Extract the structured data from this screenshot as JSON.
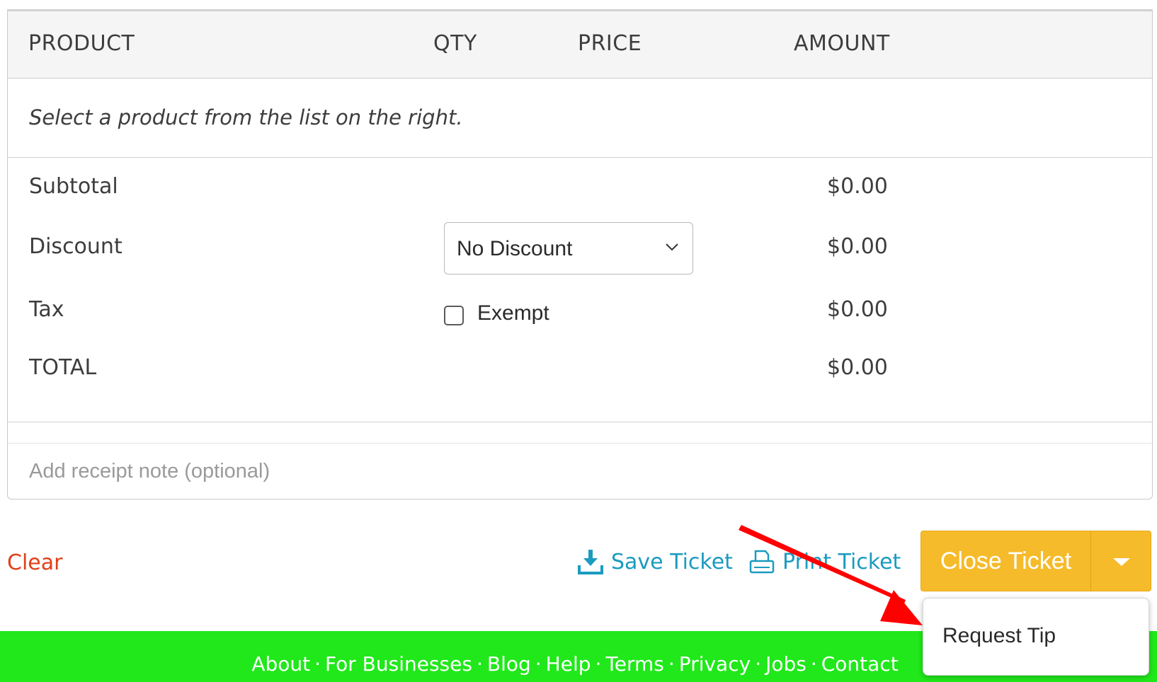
{
  "table": {
    "headers": {
      "product": "PRODUCT",
      "qty": "QTY",
      "price": "PRICE",
      "amount": "AMOUNT"
    },
    "empty_message": "Select a product from the list on the right."
  },
  "summary": {
    "subtotal": {
      "label": "Subtotal",
      "amount": "$0.00"
    },
    "discount": {
      "label": "Discount",
      "selected": "No Discount",
      "amount": "$0.00"
    },
    "tax": {
      "label": "Tax",
      "exempt_label": "Exempt",
      "exempt_checked": false,
      "amount": "$0.00"
    },
    "total": {
      "label": "TOTAL",
      "amount": "$0.00"
    }
  },
  "receipt_note": {
    "placeholder": "Add receipt note (optional)",
    "value": ""
  },
  "actions": {
    "clear": "Clear",
    "save_ticket": "Save Ticket",
    "print_ticket": "Print Ticket",
    "close_ticket": "Close Ticket",
    "dropdown_items": [
      "Request Tip"
    ]
  },
  "footer": {
    "links": [
      "About",
      "For Businesses",
      "Blog",
      "Help",
      "Terms",
      "Privacy",
      "Jobs",
      "Contact"
    ],
    "separator": "·"
  },
  "colors": {
    "accent_yellow": "#f6bb2b",
    "link_blue": "#1b9bc0",
    "clear_red": "#e0401a",
    "footer_green": "#20e81a",
    "annotation_arrow": "#ff0000"
  },
  "icons": {
    "save": "download-tray-icon",
    "print": "printer-icon",
    "discount_select": "chevron-down-icon",
    "close_menu": "caret-down-icon"
  }
}
